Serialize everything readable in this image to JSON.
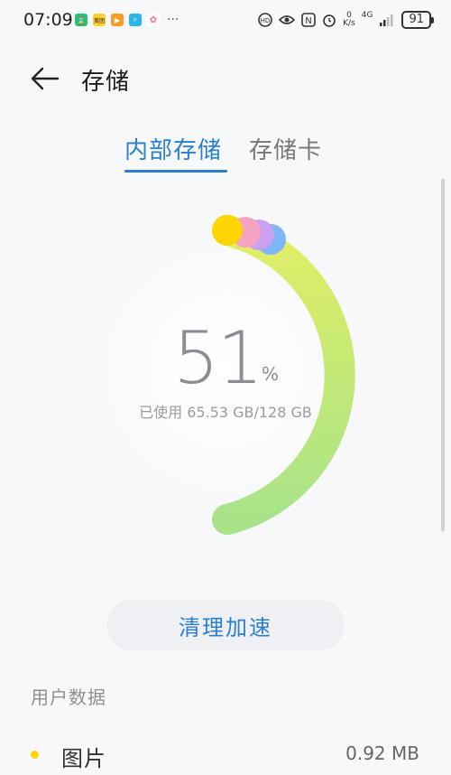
{
  "status_bar": {
    "time": "07:09",
    "app_badges": [
      "Meituan",
      "团"
    ],
    "network_speed_value": "0",
    "network_speed_unit": "K/s",
    "network_type": "4G",
    "battery": "91"
  },
  "header": {
    "title": "存储"
  },
  "tabs": [
    {
      "label": "内部存储",
      "active": true
    },
    {
      "label": "存储卡",
      "active": false
    }
  ],
  "storage": {
    "percent_number": "51",
    "percent_sign": "%",
    "usage_text": "已使用 65.53 GB/128 GB",
    "used_fraction": 0.51,
    "colors": {
      "gauge_start": "#a8e38a",
      "gauge_end": "#dff06a",
      "pictures": "#ffd400",
      "segment_pink": "#f6a3c2",
      "segment_purple": "#c8a1f0",
      "segment_blue": "#7fb6f7"
    }
  },
  "actions": {
    "clean_label": "清理加速"
  },
  "user_data": {
    "section_title": "用户数据",
    "items": [
      {
        "label": "图片",
        "value": "0.92 MB",
        "color": "#ffd400"
      }
    ]
  }
}
